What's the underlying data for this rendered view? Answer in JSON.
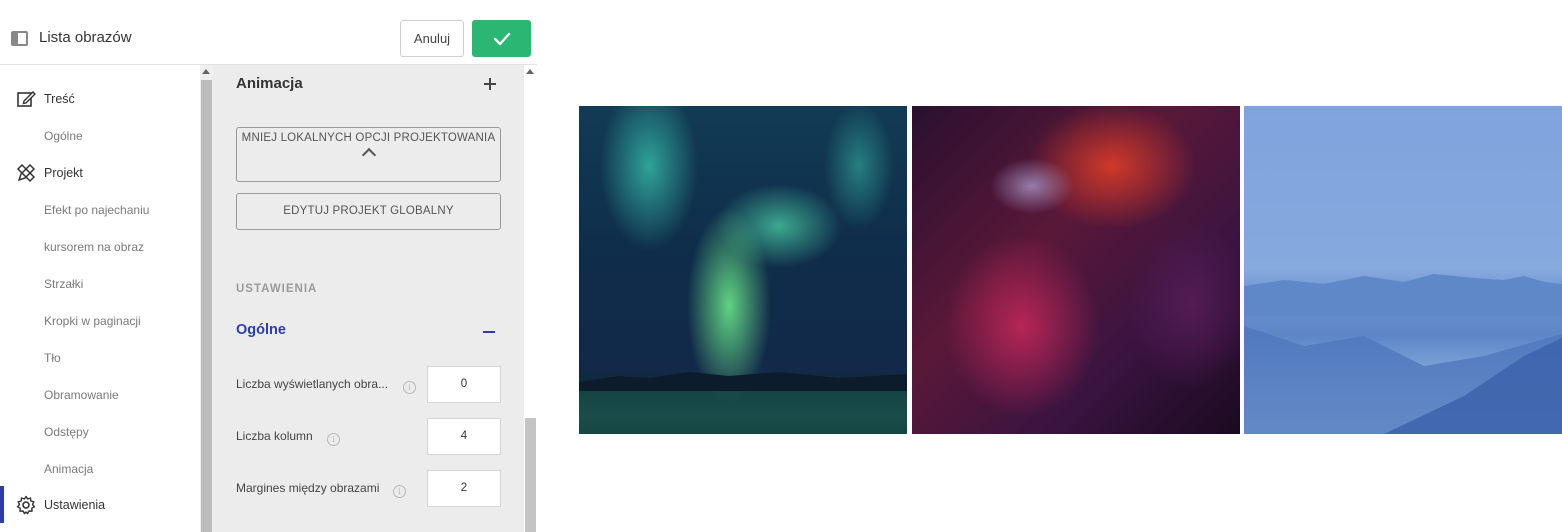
{
  "header": {
    "title": "Lista obrazów",
    "cancel_label": "Anuluj"
  },
  "nav": {
    "items": [
      {
        "label": "Treść",
        "type": "main",
        "icon": "edit-icon"
      },
      {
        "label": "Ogólne",
        "type": "sub"
      },
      {
        "label": "Projekt",
        "type": "main",
        "icon": "design-icon"
      },
      {
        "label": "Efekt po najechaniu",
        "type": "sub"
      },
      {
        "label": "kursorem na obraz",
        "type": "sub"
      },
      {
        "label": "Strzałki",
        "type": "sub"
      },
      {
        "label": "Kropki w paginacji",
        "type": "sub"
      },
      {
        "label": "Tło",
        "type": "sub"
      },
      {
        "label": "Obramowanie",
        "type": "sub"
      },
      {
        "label": "Odstępy",
        "type": "sub"
      },
      {
        "label": "Animacja",
        "type": "sub"
      },
      {
        "label": "Ustawienia",
        "type": "main",
        "icon": "gear-icon",
        "active": true
      }
    ]
  },
  "settings": {
    "section_title": "Animacja",
    "less_options_label": "MNIEJ LOKALNYCH OPCJI PROJEKTOWANIA",
    "edit_global_label": "EDYTUJ PROJEKT GLOBALNY",
    "group_heading": "USTAWIENIA",
    "subsection_title": "Ogólne",
    "fields": [
      {
        "label": "Liczba wyświetlanych obra...",
        "value": "0"
      },
      {
        "label": "Liczba kolumn",
        "value": "4"
      },
      {
        "label": "Margines między obrazami",
        "value": "2"
      }
    ]
  },
  "colors": {
    "confirm": "#2bb673",
    "accent": "#2d3ea8"
  }
}
